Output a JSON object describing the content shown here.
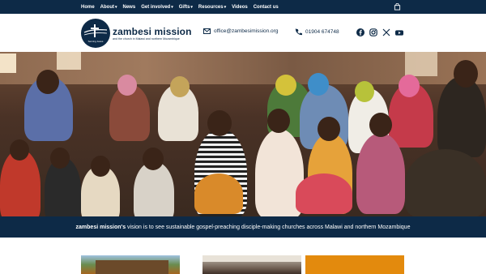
{
  "nav": {
    "items": [
      {
        "label": "Home",
        "has_dropdown": false
      },
      {
        "label": "About",
        "has_dropdown": true
      },
      {
        "label": "News",
        "has_dropdown": false
      },
      {
        "label": "Get involved",
        "has_dropdown": true
      },
      {
        "label": "Gifts",
        "has_dropdown": true
      },
      {
        "label": "Resources",
        "has_dropdown": true
      },
      {
        "label": "Videos",
        "has_dropdown": false
      },
      {
        "label": "Contact us",
        "has_dropdown": false
      }
    ],
    "cart_icon": "shopping-bag-icon"
  },
  "header": {
    "logo_title": "zambesi mission",
    "logo_tagline": "and the church in Malawi and northern Mozambique",
    "logo_mark_text": "Serving Jesus",
    "email": "office@zambesimission.org",
    "phone": "01904 674748",
    "social": [
      "facebook-icon",
      "instagram-icon",
      "x-icon",
      "youtube-icon"
    ]
  },
  "hero": {
    "image_subject": "congregation-photo"
  },
  "vision": {
    "brand": "zambesi mission's",
    "text": " vision is to see sustainable gospel-preaching disciple-making churches across Malawi and northern Mozambique"
  },
  "colors": {
    "navy": "#0d2a47",
    "orange": "#e38a0d",
    "white": "#ffffff"
  }
}
